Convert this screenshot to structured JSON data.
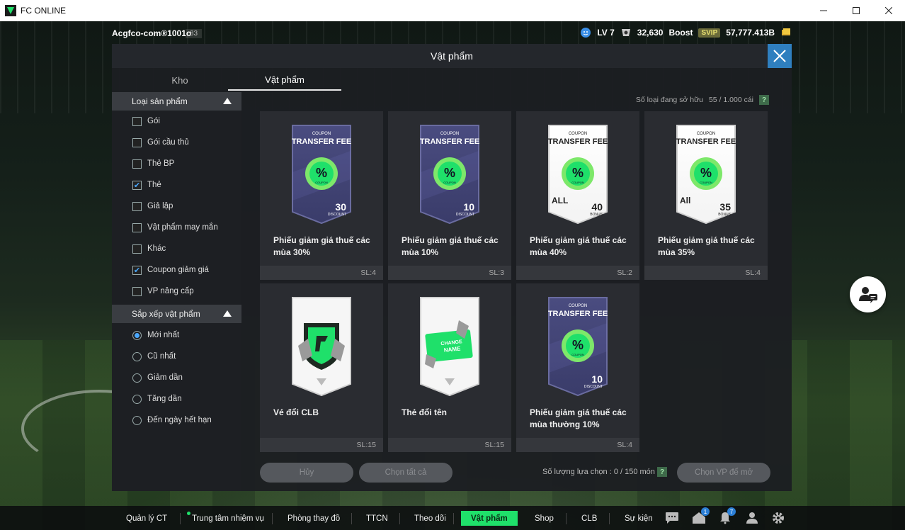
{
  "window": {
    "title": "FC ONLINE",
    "icon": "fc-logo-icon"
  },
  "topbar": {
    "account": "Acgfco-com®1001o",
    "account_level": "83",
    "level": "LV 7",
    "coins": "32,630",
    "boost_label": "Boost",
    "svip": "SVIP",
    "bp": "57,777.413B"
  },
  "dialog": {
    "title": "Vật phẩm",
    "tabs": [
      {
        "label": "Kho"
      },
      {
        "label": "Vật phẩm"
      }
    ],
    "owned_label": "Số loại đang sở hữu",
    "owned_value": "55 / 1.000 cái",
    "help": "?"
  },
  "filters": {
    "section1": "Loại sản phẩm",
    "options": [
      {
        "label": "Gói",
        "checked": false
      },
      {
        "label": "Gói cầu thủ",
        "checked": false
      },
      {
        "label": "Thẻ BP",
        "checked": false
      },
      {
        "label": "Thẻ",
        "checked": true
      },
      {
        "label": "Giả lập",
        "checked": false
      },
      {
        "label": "Vật phẩm may mắn",
        "checked": false
      },
      {
        "label": "Khác",
        "checked": false
      },
      {
        "label": "Coupon giảm giá",
        "checked": true
      },
      {
        "label": "VP nâng cấp",
        "checked": false
      }
    ],
    "section2": "Sắp xếp vật phẩm",
    "sort_options": [
      {
        "label": "Mới nhất",
        "selected": true
      },
      {
        "label": "Cũ nhất",
        "selected": false
      },
      {
        "label": "Giảm dần",
        "selected": false
      },
      {
        "label": "Tăng dần",
        "selected": false
      },
      {
        "label": "Đến ngày hết hạn",
        "selected": false
      }
    ]
  },
  "items": [
    {
      "name": "Phiếu giảm giá thuế các mùa 30%",
      "qty": "SL:4",
      "card": {
        "top": "COUPON",
        "title": "TRANSFER FEE",
        "pct": "30",
        "sub": "DISCOUNT",
        "style": "dark",
        "tag": ""
      }
    },
    {
      "name": "Phiếu giảm giá thuế các mùa 10%",
      "qty": "SL:3",
      "card": {
        "top": "COUPON",
        "title": "TRANSFER FEE",
        "pct": "10",
        "sub": "DISCOUNT",
        "style": "dark",
        "tag": ""
      }
    },
    {
      "name": "Phiếu giảm giá thuế các mùa 40%",
      "qty": "SL:2",
      "card": {
        "top": "COUPON",
        "title": "TRANSFER FEE",
        "pct": "40",
        "sub": "BONUS",
        "style": "light",
        "tag": "ALL"
      }
    },
    {
      "name": "Phiếu giảm giá thuế các mùa 35%",
      "qty": "SL:4",
      "card": {
        "top": "COUPON",
        "title": "TRANSFER FEE",
        "pct": "35",
        "sub": "BONUS",
        "style": "light",
        "tag": "All"
      }
    },
    {
      "name": "Vé đổi CLB",
      "qty": "SL:15",
      "card": {
        "style": "club"
      }
    },
    {
      "name": "Thẻ đổi tên",
      "qty": "SL:15",
      "card": {
        "style": "rename",
        "label1": "CHANGE",
        "label2": "NAME"
      }
    },
    {
      "name": "Phiếu giảm giá thuế các mùa thường 10%",
      "qty": "SL:4",
      "card": {
        "top": "COUPON",
        "title": "TRANSFER FEE",
        "pct": "10",
        "sub": "DISCOUNT",
        "style": "dark",
        "tag": ""
      }
    }
  ],
  "coupon_badge": {
    "symbol": "%",
    "text": "COUPON"
  },
  "buttons": {
    "cancel": "Hủy",
    "select_all": "Chọn tất cả",
    "select_count_label": "Số lượng lựa chọn : 0 / 150 món",
    "sell": "Chọn VP để mở"
  },
  "bottom_nav": [
    {
      "label": "Quản lý CT"
    },
    {
      "label": "Trung tâm nhiệm vụ"
    },
    {
      "label": "Phòng thay đồ"
    },
    {
      "label": "TTCN"
    },
    {
      "label": "Theo dõi"
    },
    {
      "label": "Vật phẩm"
    },
    {
      "label": "Shop"
    },
    {
      "label": "CLB"
    },
    {
      "label": "Sự kiện"
    }
  ],
  "nav_badges": {
    "mail": "1",
    "notifications": "7"
  },
  "colors": {
    "accent": "#1fe06a",
    "close_bg": "#2f7fbf",
    "checkbox": "#4aa8ff"
  }
}
